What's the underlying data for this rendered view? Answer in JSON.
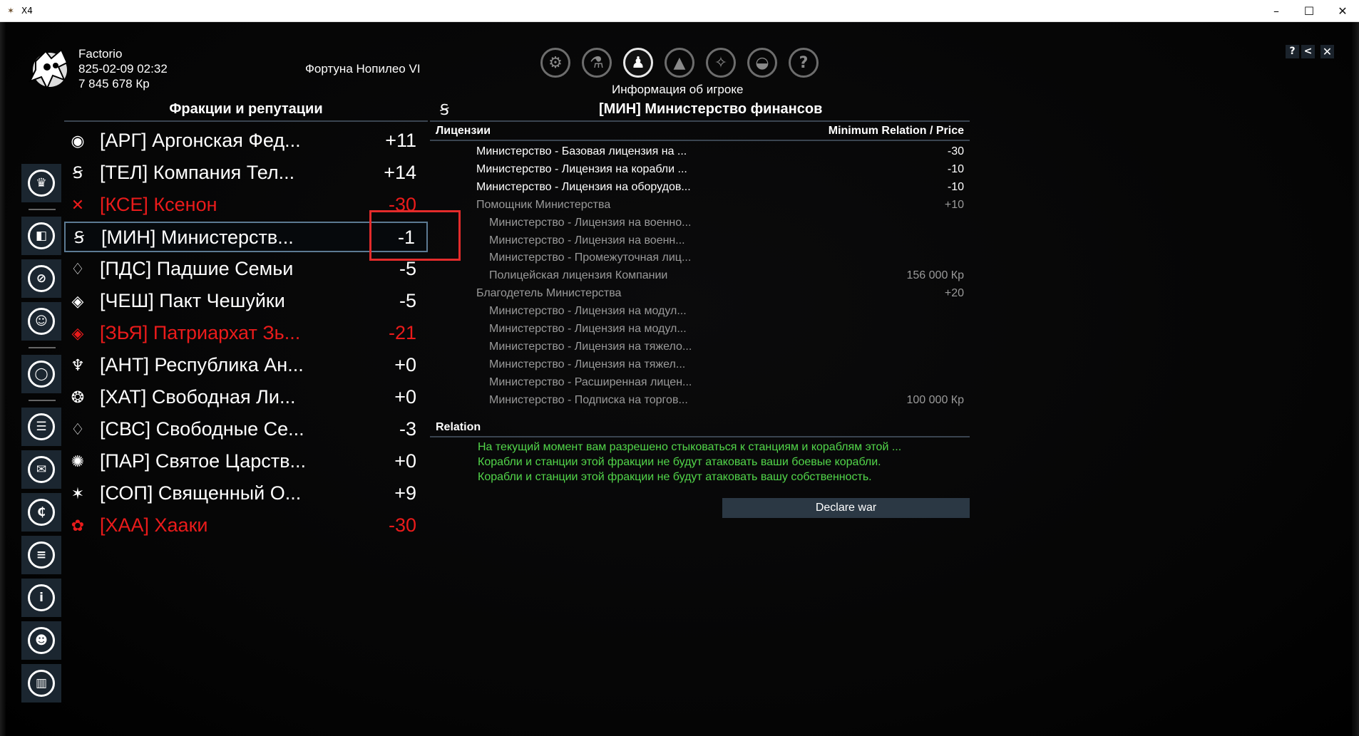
{
  "window": {
    "title": "X4",
    "controls": {
      "minimize": "–",
      "maximize": "☐",
      "close": "✕"
    }
  },
  "player": {
    "name": "Factorio",
    "datetime": "825-02-09 02:32",
    "money": "7 845 678 Кр",
    "ship": "Фортуна Нопилео VI"
  },
  "top_menu": {
    "active_label": "Информация об игроке",
    "icons": [
      "gear-icon",
      "flask-icon",
      "player-icon",
      "ship-icon",
      "map-icon",
      "encyclopedia-icon",
      "help-icon"
    ]
  },
  "top_right": {
    "help": "?",
    "back": "<",
    "close": "✕"
  },
  "sidebar": {
    "icons": [
      "crown-icon",
      "shield-book-icon",
      "no-symbol-icon",
      "helmet-icon",
      "globe-icon",
      "cargo-icon",
      "mail-icon",
      "credits-icon",
      "list-icon",
      "info-icon",
      "people-icon",
      "stats-icon"
    ]
  },
  "factions_panel": {
    "title": "Фракции и репутации",
    "factions": [
      {
        "name": "[АРГ] Аргонская Фед...",
        "value": "+11",
        "hostile": false,
        "icon": "argon-icon"
      },
      {
        "name": "[ТЕЛ] Компания Тел...",
        "value": "+14",
        "hostile": false,
        "icon": "teladi-icon"
      },
      {
        "name": "[КСЕ] Ксенон",
        "value": "-30",
        "hostile": true,
        "icon": "xenon-icon"
      },
      {
        "name": "[МИН] Министерств...",
        "value": "-1",
        "hostile": false,
        "icon": "ministry-icon",
        "selected": true
      },
      {
        "name": "[ПДС] Падшие Семьи",
        "value": "-5",
        "hostile": false,
        "icon": "fallen-families-icon"
      },
      {
        "name": "[ЧЕШ] Пакт Чешуйки",
        "value": "-5",
        "hostile": false,
        "icon": "scale-pact-icon"
      },
      {
        "name": "[ЗЬЯ] Патриархат Зь...",
        "value": "-21",
        "hostile": true,
        "icon": "zyarth-icon"
      },
      {
        "name": "[АНТ] Республика Ан...",
        "value": "+0",
        "hostile": false,
        "icon": "antigone-icon"
      },
      {
        "name": "[ХАТ] Свободная Ли...",
        "value": "+0",
        "hostile": false,
        "icon": "hatikvah-icon"
      },
      {
        "name": "[СВС] Свободные Се...",
        "value": "-3",
        "hostile": false,
        "icon": "free-families-icon"
      },
      {
        "name": "[ПАР] Святое Царств...",
        "value": "+0",
        "hostile": false,
        "icon": "paranid-icon"
      },
      {
        "name": "[СОП] Священный О...",
        "value": "+9",
        "hostile": false,
        "icon": "holy-order-icon"
      },
      {
        "name": "[ХАА] Хааки",
        "value": "-30",
        "hostile": true,
        "icon": "kha-ak-icon"
      }
    ]
  },
  "detail_panel": {
    "title": "[МИН] Министерство финансов",
    "licenses_header": "Лицензии",
    "relation_price_header": "Minimum Relation / Price",
    "licenses": [
      {
        "name": "Министерство - Базовая лицензия на ...",
        "value": "-30",
        "indent": 0,
        "active": true
      },
      {
        "name": "Министерство - Лицензия на корабли ...",
        "value": "-10",
        "indent": 0,
        "active": true
      },
      {
        "name": "Министерство - Лицензия на оборудов...",
        "value": "-10",
        "indent": 0,
        "active": true
      },
      {
        "name": "Помощник Министерства",
        "value": "+10",
        "indent": 0,
        "active": false
      },
      {
        "name": "Министерство - Лицензия на военно...",
        "value": "",
        "indent": 1,
        "active": false
      },
      {
        "name": "Министерство - Лицензия на военн...",
        "value": "",
        "indent": 1,
        "active": false
      },
      {
        "name": "Министерство - Промежуточная лиц...",
        "value": "",
        "indent": 1,
        "active": false
      },
      {
        "name": "Полицейская лицензия Компании",
        "value": "156 000 Кр",
        "indent": 1,
        "active": false
      },
      {
        "name": "Благодетель Министерства",
        "value": "+20",
        "indent": 0,
        "active": false
      },
      {
        "name": "Министерство - Лицензия на модул...",
        "value": "",
        "indent": 1,
        "active": false
      },
      {
        "name": "Министерство - Лицензия на модул...",
        "value": "",
        "indent": 1,
        "active": false
      },
      {
        "name": "Министерство - Лицензия на тяжело...",
        "value": "",
        "indent": 1,
        "active": false
      },
      {
        "name": "Министерство - Лицензия на тяжел...",
        "value": "",
        "indent": 1,
        "active": false
      },
      {
        "name": "Министерство - Расширенная лицен...",
        "value": "",
        "indent": 1,
        "active": false
      },
      {
        "name": "Министерство - Подписка на торгов...",
        "value": "100 000 Кр",
        "indent": 1,
        "active": false
      }
    ],
    "relation_header": "Relation",
    "relation_lines": [
      "На текущий момент вам разрешено стыковаться к станциям и кораблям этой ...",
      "Корабли и станции этой фракции не будут атаковать ваши боевые корабли.",
      "Корабли и станции этой фракции не будут атаковать вашу собственность."
    ],
    "declare_war_label": "Declare war"
  },
  "colors": {
    "hostile": "#ea1b1b",
    "relation_text": "#52d64a",
    "panel_button": "#2b3844",
    "selection_border": "#5c7a93",
    "highlight_box": "#e32b2b"
  }
}
